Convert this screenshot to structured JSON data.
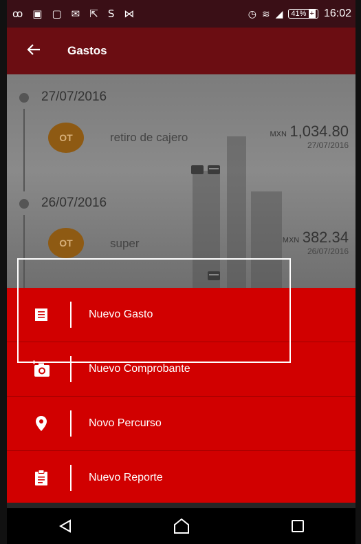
{
  "status_bar": {
    "battery_percent": "41%",
    "time": "16:02"
  },
  "app_bar": {
    "title": "Gastos"
  },
  "expenses": [
    {
      "date": "27/07/2016",
      "avatar": "OT",
      "description": "retiro de cajero",
      "currency": "MXN",
      "amount": "1,034.80",
      "item_date": "27/07/2016"
    },
    {
      "date": "26/07/2016",
      "avatar": "OT",
      "description": "super",
      "currency": "MXN",
      "amount": "382.34",
      "item_date": "26/07/2016"
    }
  ],
  "menu": [
    {
      "label": "Nuevo Gasto",
      "icon": "receipt-icon"
    },
    {
      "label": "Nuevo Comprobante",
      "icon": "add-photo-icon"
    },
    {
      "label": "Novo Percurso",
      "icon": "location-pin-icon"
    },
    {
      "label": "Nuevo Reporte",
      "icon": "clipboard-icon"
    }
  ],
  "colors": {
    "menu_red": "#d10000",
    "app_bar": "#6b0d12",
    "avatar": "#8e5a13"
  }
}
